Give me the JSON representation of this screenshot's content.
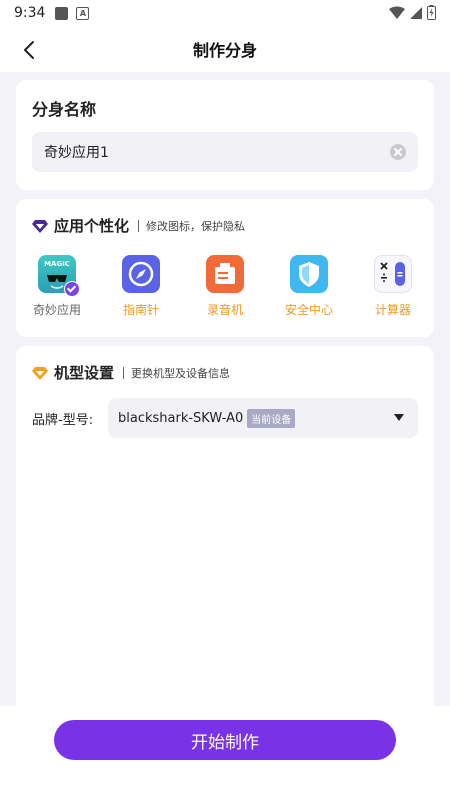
{
  "status_bar": {
    "time": "9:34",
    "a_badge": "A"
  },
  "header": {
    "title": "制作分身"
  },
  "name_section": {
    "title": "分身名称",
    "input_value": "奇妙应用1"
  },
  "personalize": {
    "title": "应用个性化",
    "subtitle": "修改图标，保护隐私",
    "apps": [
      {
        "label": "奇妙应用",
        "icon": "magic-app-icon",
        "selected": true,
        "icon_text": "MAGIC"
      },
      {
        "label": "指南针",
        "icon": "compass-icon",
        "selected": false
      },
      {
        "label": "录音机",
        "icon": "recorder-icon",
        "selected": false
      },
      {
        "label": "安全中心",
        "icon": "shield-icon",
        "selected": false
      },
      {
        "label": "计算器",
        "icon": "calculator-icon",
        "selected": false
      }
    ]
  },
  "model": {
    "title": "机型设置",
    "subtitle": "更换机型及设备信息",
    "label": "品牌-型号:",
    "value": "blackshark-SKW-A0",
    "badge": "当前设备"
  },
  "actions": {
    "start_label": "开始制作"
  },
  "colors": {
    "accent": "#7a32e6",
    "orange": "#f09a1c",
    "bg": "#f3f2f8"
  }
}
